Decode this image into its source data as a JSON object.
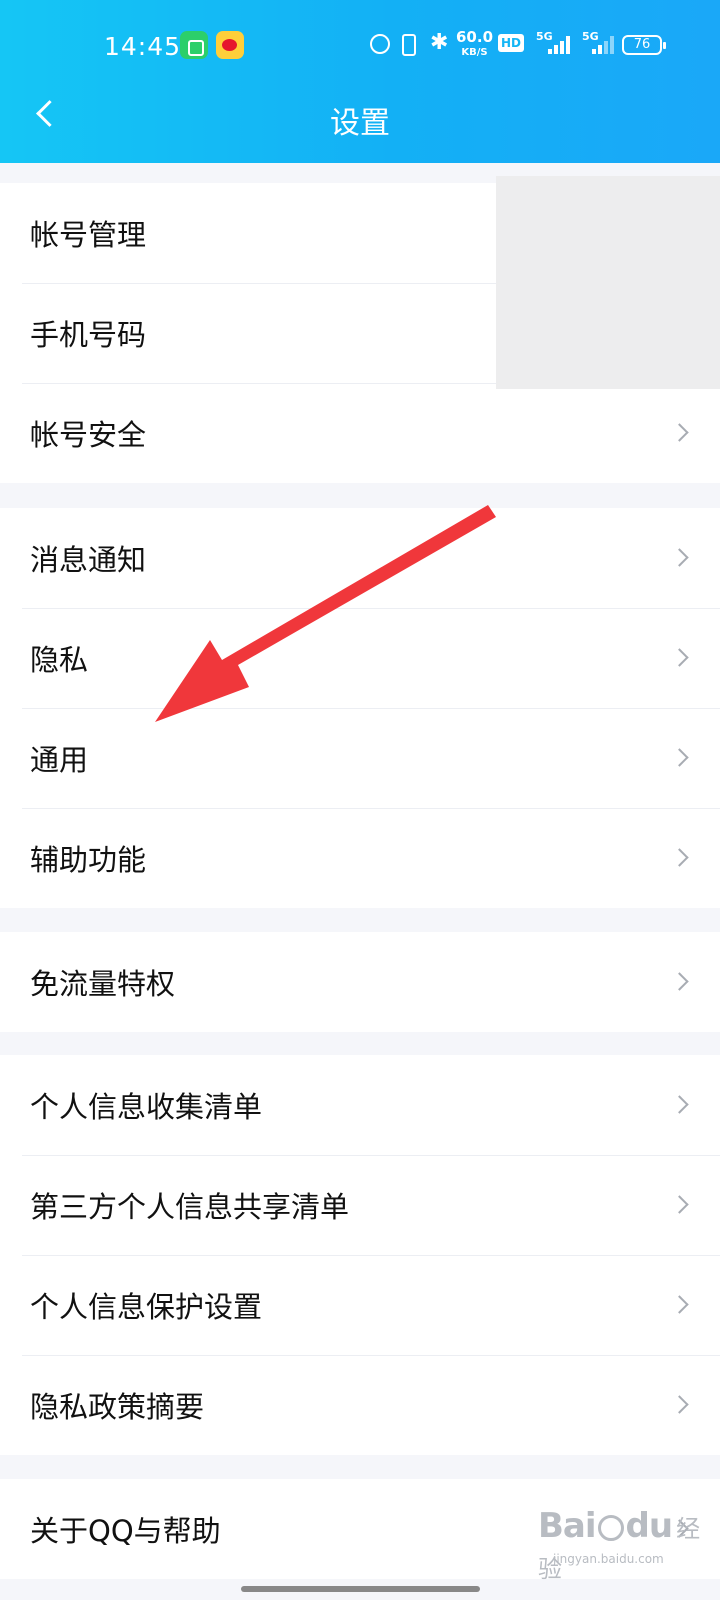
{
  "status_bar": {
    "time": "14:45",
    "net_speed": "60.0",
    "net_speed_unit": "KB/S",
    "hd_label": "HD",
    "signal1_label": "5G",
    "signal2_label": "5G",
    "battery": "76"
  },
  "header": {
    "title": "设置"
  },
  "groups": [
    {
      "items": [
        {
          "label": "帐号管理"
        },
        {
          "label": "手机号码"
        },
        {
          "label": "帐号安全"
        }
      ]
    },
    {
      "items": [
        {
          "label": "消息通知"
        },
        {
          "label": "隐私"
        },
        {
          "label": "通用"
        },
        {
          "label": "辅助功能"
        }
      ]
    },
    {
      "items": [
        {
          "label": "免流量特权"
        }
      ]
    },
    {
      "items": [
        {
          "label": "个人信息收集清单"
        },
        {
          "label": "第三方个人信息共享清单"
        },
        {
          "label": "个人信息保护设置"
        },
        {
          "label": "隐私政策摘要"
        }
      ]
    },
    {
      "items": [
        {
          "label": "关于QQ与帮助"
        }
      ]
    }
  ],
  "watermark": {
    "brand_left": "Bai",
    "brand_right": "du",
    "brand_cn": "经验",
    "url": "jingyan.baidu.com"
  },
  "colors": {
    "header_gradient_start": "#15c6f5",
    "header_gradient_end": "#1aa8f8",
    "annotation_arrow": "#f0373b"
  }
}
